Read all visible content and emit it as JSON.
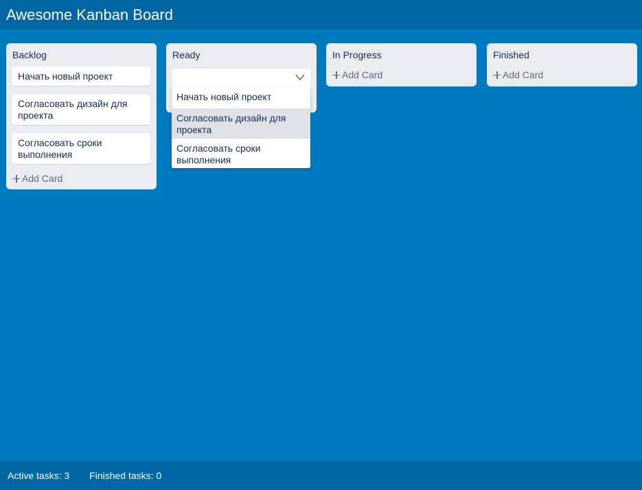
{
  "header": {
    "title": "Awesome Kanban Board"
  },
  "columns": [
    {
      "title": "Backlog",
      "cards": [
        "Начать новый проект",
        "Согласовать дизайн для проекта",
        "Согласовать сроки выполнения"
      ],
      "add_card_label": "Add Card"
    },
    {
      "title": "Ready",
      "select_value": "",
      "cards": []
    },
    {
      "title": "In Progress",
      "cards": [],
      "add_card_label": "Add Card"
    },
    {
      "title": "Finished",
      "cards": [],
      "add_card_label": "Add Card"
    }
  ],
  "dropdown": {
    "options": [
      "Начать новый проект",
      "Согласовать дизайн для проекта",
      "Согласовать сроки выполнения"
    ],
    "highlighted_index": 1
  },
  "footer": {
    "active_tasks_label": "Active tasks: 3",
    "finished_tasks_label": "Finished tasks: 0"
  },
  "icons": {
    "add": "plus-icon",
    "select": "chevron-down-icon"
  },
  "colors": {
    "background": "#0079bf",
    "header": "#0067a3",
    "column": "#ebecf0",
    "card": "#ffffff",
    "highlight": "#dfe1e6"
  }
}
